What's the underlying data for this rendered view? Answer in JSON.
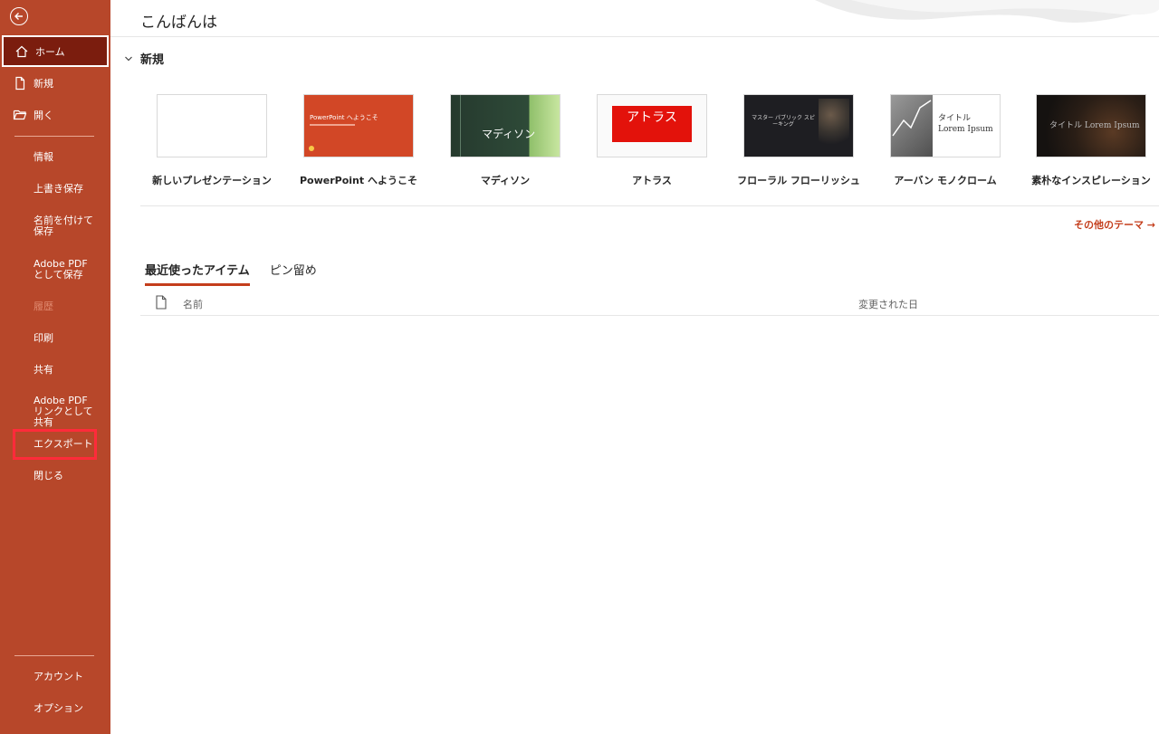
{
  "greeting": "こんばんは",
  "sidebar": {
    "top_items": [
      {
        "label": "ホーム",
        "icon": "home-icon"
      },
      {
        "label": "新規",
        "icon": "new-file-icon"
      },
      {
        "label": "開く",
        "icon": "open-folder-icon"
      }
    ],
    "sub_items": [
      {
        "label": "情報"
      },
      {
        "label": "上書き保存"
      },
      {
        "label": "名前を付けて保存"
      },
      {
        "label": "Adobe PDF として保存"
      },
      {
        "label": "履歴"
      },
      {
        "label": "印刷"
      },
      {
        "label": "共有"
      },
      {
        "label": "Adobe PDF リンクとして共有"
      },
      {
        "label": "エクスポート"
      },
      {
        "label": "閉じる"
      }
    ],
    "bottom_items": [
      {
        "label": "アカウント"
      },
      {
        "label": "オプション"
      }
    ]
  },
  "new_section": {
    "title": "新規",
    "templates": [
      {
        "label": "新しいプレゼンテーション"
      },
      {
        "label": "PowerPoint へようこそ",
        "thumb_text": "PowerPoint へようこそ"
      },
      {
        "label": "マディソン",
        "thumb_text": "マディソン"
      },
      {
        "label": "アトラス",
        "thumb_text": "アトラス"
      },
      {
        "label": "フローラル フローリッシュ",
        "thumb_text": "マスター パブリック スピーキング"
      },
      {
        "label": "アーバン モノクローム",
        "thumb_text": "タイトル Lorem Ipsum"
      },
      {
        "label": "素朴なインスピレーション",
        "thumb_text": "タイトル Lorem Ipsum"
      }
    ],
    "more_link": "その他のテーマ →"
  },
  "recent": {
    "tabs": [
      {
        "label": "最近使ったアイテム"
      },
      {
        "label": "ピン留め"
      }
    ],
    "columns": {
      "name": "名前",
      "modified": "変更された日"
    }
  },
  "colors": {
    "sidebar": "#b7472a",
    "active": "#7b1d0e",
    "accent": "#c43e1c",
    "highlight": "#ff2b3a"
  }
}
